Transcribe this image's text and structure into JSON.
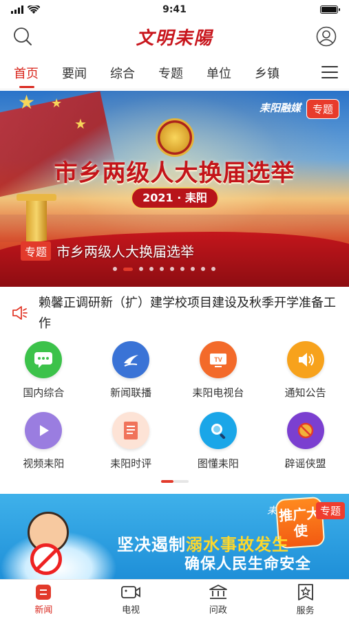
{
  "status_bar": {
    "time": "9:41"
  },
  "header": {
    "logo": "文明耒陽"
  },
  "tabs": [
    {
      "label": "首页",
      "active": true
    },
    {
      "label": "要闻",
      "active": false
    },
    {
      "label": "综合",
      "active": false
    },
    {
      "label": "专题",
      "active": false
    },
    {
      "label": "单位",
      "active": false
    },
    {
      "label": "乡镇",
      "active": false
    }
  ],
  "banner": {
    "brand": "耒阳融媒",
    "corner_tag": "专题",
    "headline": "市乡两级人大换届选举",
    "year_label": "2021 · 耒阳",
    "caption_tag": "专题",
    "caption_title": "市乡两级人大换届选举",
    "slide_count": 10,
    "active_slide": 2
  },
  "notice": {
    "text": "赖馨正调研新（扩）建学校项目建设及秋季开学准备工作"
  },
  "shortcuts": [
    {
      "label": "国内综合",
      "icon": "chat-icon",
      "color": "#3cc24a"
    },
    {
      "label": "新闻联播",
      "icon": "swoosh-icon",
      "color": "#3a73d6"
    },
    {
      "label": "耒阳电视台",
      "icon": "tv-icon",
      "color": "#f36a2a"
    },
    {
      "label": "通知公告",
      "icon": "speaker-icon",
      "color": "#f7a21c"
    },
    {
      "label": "视频耒阳",
      "icon": "play-icon",
      "color": "#9a7de0"
    },
    {
      "label": "耒阳时评",
      "icon": "document-icon",
      "color": "#f08a6a"
    },
    {
      "label": "图懂耒阳",
      "icon": "magnifier-icon",
      "color": "#1aa6e8"
    },
    {
      "label": "辟谣侠盟",
      "icon": "rumor-icon",
      "color": "#7b3fd0"
    }
  ],
  "promo": {
    "brand": "耒",
    "badge_text": "推广大使",
    "topic_tag": "专题",
    "line1_prefix": "坚决遏制",
    "line1_highlight": "溺水事故发生",
    "line2": "确保人民生命安全"
  },
  "bottom_nav": [
    {
      "label": "新闻",
      "icon": "news-icon",
      "active": true
    },
    {
      "label": "电视",
      "icon": "video-camera-icon",
      "active": false
    },
    {
      "label": "问政",
      "icon": "government-icon",
      "active": false
    },
    {
      "label": "服务",
      "icon": "star-box-icon",
      "active": false
    }
  ],
  "colors": {
    "accent": "#d9261c",
    "promo_bg": "#2a9fe2"
  }
}
